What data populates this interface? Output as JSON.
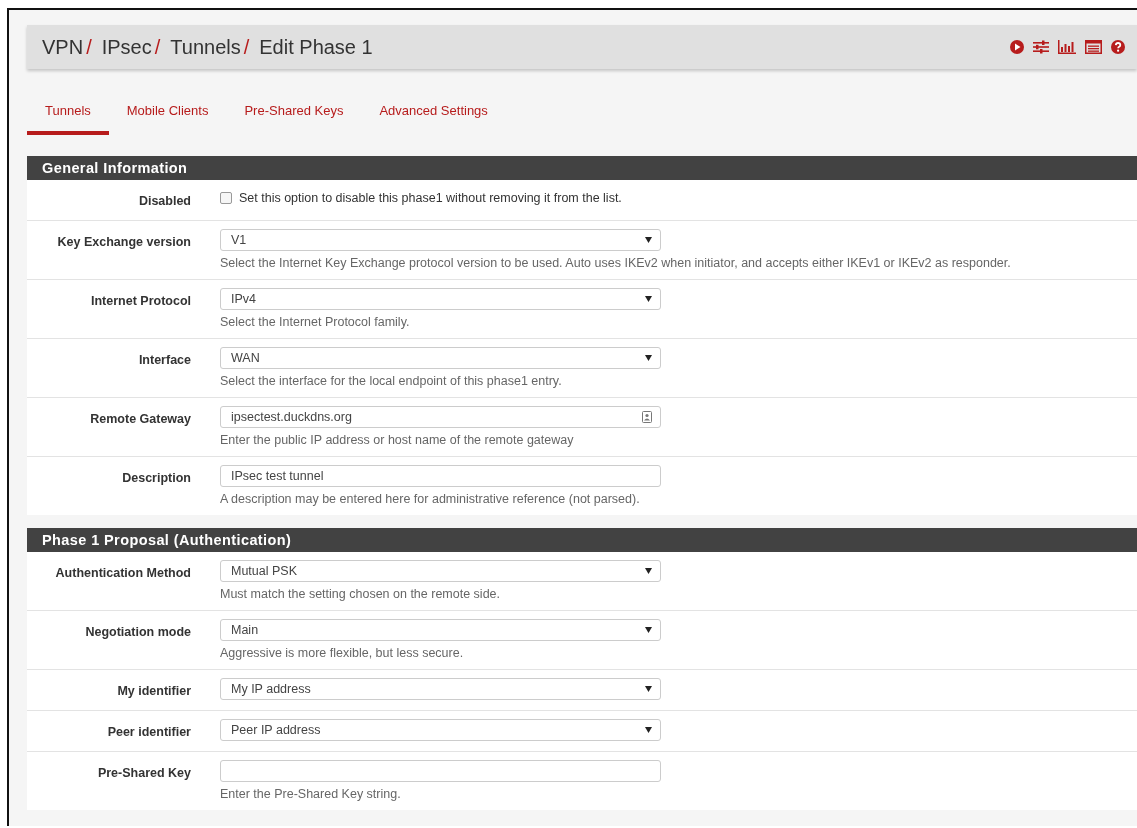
{
  "breadcrumb": [
    {
      "label": "VPN",
      "separator": "/"
    },
    {
      "label": "IPsec",
      "separator": "/"
    },
    {
      "label": "Tunnels",
      "separator": "/"
    },
    {
      "label": "Edit Phase 1"
    }
  ],
  "tabs": [
    {
      "label": "Tunnels",
      "selected": true
    },
    {
      "label": "Mobile Clients",
      "selected": false
    },
    {
      "label": "Pre-Shared Keys",
      "selected": false
    },
    {
      "label": "Advanced Settings",
      "selected": false
    }
  ],
  "sections": [
    {
      "title": "General Information",
      "rows": [
        {
          "label": "Disabled",
          "kind": "checkbox",
          "checked": false,
          "text": "Set this option to disable this phase1 without removing it from the list."
        },
        {
          "label": "Key Exchange version",
          "kind": "select",
          "value": "V1",
          "help": "Select the Internet Key Exchange protocol version to be used. Auto uses IKEv2 when initiator, and accepts either IKEv1 or IKEv2 as responder."
        },
        {
          "label": "Internet Protocol",
          "kind": "select",
          "value": "IPv4",
          "help": "Select the Internet Protocol family."
        },
        {
          "label": "Interface",
          "kind": "select",
          "value": "WAN",
          "help": "Select the interface for the local endpoint of this phase1 entry."
        },
        {
          "label": "Remote Gateway",
          "kind": "text",
          "value": "ipsectest.duckdns.org",
          "autofill": true,
          "help": "Enter the public IP address or host name of the remote gateway"
        },
        {
          "label": "Description",
          "kind": "text",
          "value": "IPsec test tunnel",
          "help": "A description may be entered here for administrative reference (not parsed)."
        }
      ]
    },
    {
      "title": "Phase 1 Proposal (Authentication)",
      "rows": [
        {
          "label": "Authentication Method",
          "kind": "select",
          "value": "Mutual PSK",
          "help": "Must match the setting chosen on the remote side."
        },
        {
          "label": "Negotiation mode",
          "kind": "select",
          "value": "Main",
          "help": "Aggressive is more flexible, but less secure."
        },
        {
          "label": "My identifier",
          "kind": "select",
          "value": "My IP address"
        },
        {
          "label": "Peer identifier",
          "kind": "select",
          "value": "Peer IP address"
        },
        {
          "label": "Pre-Shared Key",
          "kind": "text",
          "value": "",
          "help": "Enter the Pre-Shared Key string."
        }
      ]
    }
  ]
}
